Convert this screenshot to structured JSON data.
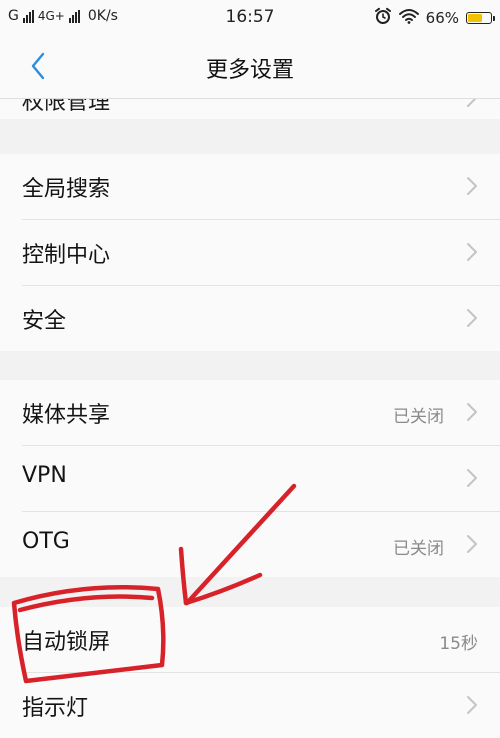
{
  "status_bar": {
    "carrier": "G",
    "network": "4G+",
    "speed": "0K/s",
    "time": "16:57",
    "battery_text": "66%",
    "battery_level": 0.66,
    "battery_color": "#f2c200",
    "icons": [
      "signal-icon",
      "alarm-icon",
      "wifi-icon",
      "battery-icon"
    ]
  },
  "header": {
    "title": "更多设置",
    "back_icon": "chevron-left-icon",
    "accent_color": "#2b8de0"
  },
  "partial_item": {
    "label": "权限管理"
  },
  "groups": [
    {
      "items": [
        {
          "label": "全局搜索"
        },
        {
          "label": "控制中心"
        },
        {
          "label": "安全"
        }
      ]
    },
    {
      "items": [
        {
          "label": "媒体共享",
          "value": "已关闭"
        },
        {
          "label": "VPN"
        },
        {
          "label": "OTG",
          "value": "已关闭"
        }
      ]
    },
    {
      "items": [
        {
          "label": "自动锁屏",
          "value": "15秒"
        },
        {
          "label": "指示灯"
        }
      ]
    }
  ],
  "annotation": {
    "color": "#d8222a",
    "shapes": [
      "arrow-annotation",
      "circle-annotation"
    ]
  }
}
